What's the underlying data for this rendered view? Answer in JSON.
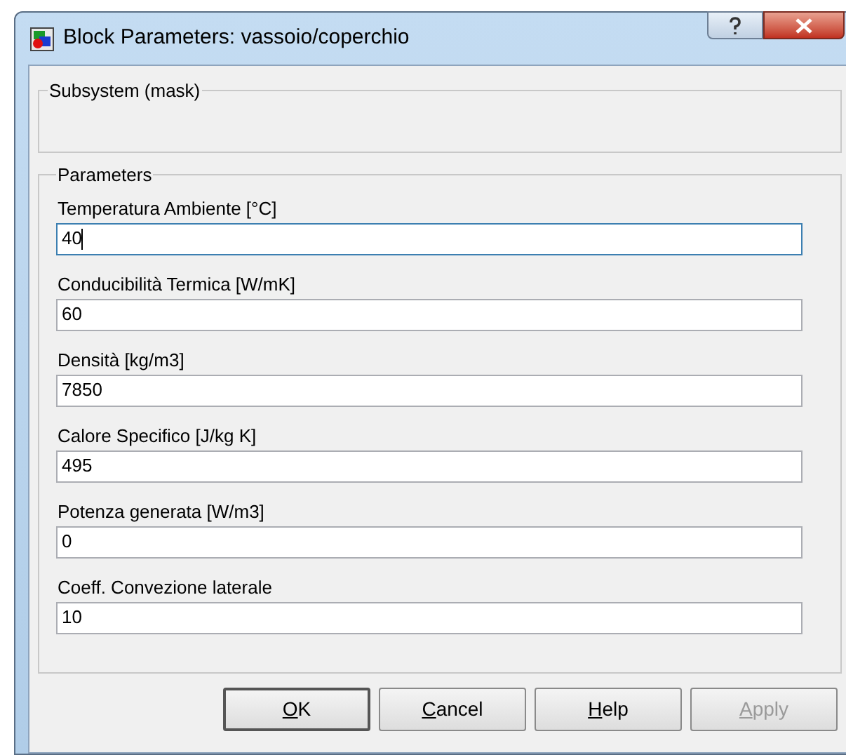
{
  "window": {
    "title": "Block Parameters: vassoio/coperchio"
  },
  "subsystem": {
    "legend": "Subsystem (mask)"
  },
  "parameters": {
    "legend": "Parameters",
    "fields": [
      {
        "label": "Temperatura Ambiente [°C]",
        "value": "40",
        "focused": true
      },
      {
        "label": "Conducibilità Termica [W/mK]",
        "value": "60",
        "focused": false
      },
      {
        "label": "Densità [kg/m3]",
        "value": "7850",
        "focused": false
      },
      {
        "label": "Calore Specifico [J/kg K]",
        "value": "495",
        "focused": false
      },
      {
        "label": "Potenza generata [W/m3]",
        "value": "0",
        "focused": false
      },
      {
        "label": "Coeff. Convezione laterale",
        "value": "10",
        "focused": false
      }
    ]
  },
  "buttons": [
    {
      "label": "OK",
      "default": true,
      "disabled": false
    },
    {
      "label": "Cancel",
      "default": false,
      "disabled": false
    },
    {
      "label": "Help",
      "default": false,
      "disabled": false
    },
    {
      "label": "Apply",
      "default": false,
      "disabled": true
    }
  ]
}
